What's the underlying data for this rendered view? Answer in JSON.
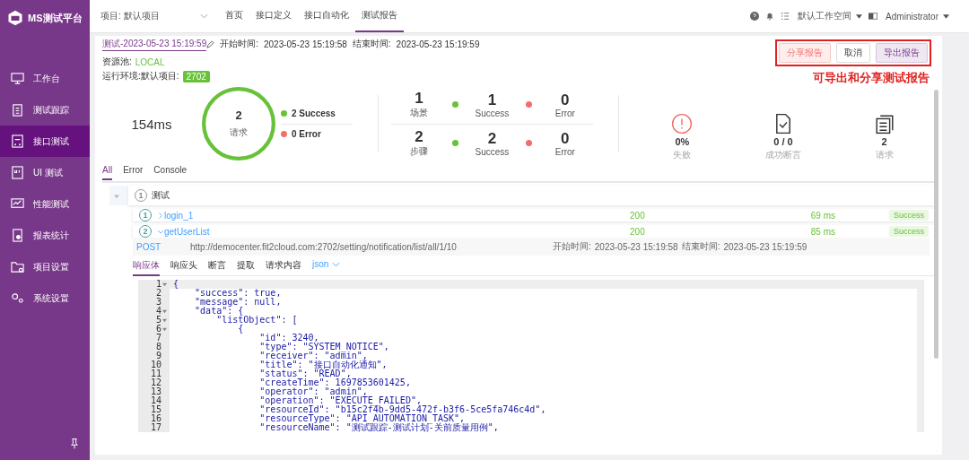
{
  "sidebar": {
    "logo": "MS测试平台",
    "items": [
      {
        "label": "工作台",
        "selected": false
      },
      {
        "label": "测试跟踪",
        "selected": false
      },
      {
        "label": "接口测试",
        "selected": true
      },
      {
        "label": "UI 测试",
        "selected": false
      },
      {
        "label": "性能测试",
        "selected": false
      },
      {
        "label": "报表统计",
        "selected": false
      },
      {
        "label": "项目设置",
        "selected": false
      },
      {
        "label": "系统设置",
        "selected": false
      }
    ]
  },
  "header": {
    "project": "项目: 默认项目",
    "nav": [
      {
        "label": "首页",
        "selected": false
      },
      {
        "label": "接口定义",
        "selected": false
      },
      {
        "label": "接口自动化",
        "selected": false
      },
      {
        "label": "测试报告",
        "selected": true
      }
    ],
    "workspace": "默认工作空间",
    "user": "Administrator"
  },
  "report": {
    "name": "测试-2023-05-23 15:19:59",
    "start_label": "开始时间:",
    "start": "2023-05-23 15:19:58",
    "end_label": "结束时间:",
    "end": "2023-05-23 15:19:59",
    "pool_label": "资源池:",
    "pool": "LOCAL",
    "env_label": "运行环境:默认项目:",
    "env_tag": "2702",
    "actions": [
      {
        "label": "分享报告",
        "kind": "share"
      },
      {
        "label": "取消",
        "kind": "plain"
      },
      {
        "label": "导出报告",
        "kind": "export"
      }
    ],
    "annotation": "可导出和分享测试报告",
    "duration": "154ms",
    "ring": {
      "count": "2",
      "label": "请求",
      "level": 1
    },
    "legend": [
      {
        "text": "2 Success",
        "color": "#67c23a"
      },
      {
        "text": "0 Error",
        "color": "#f56c6c"
      }
    ],
    "counts": [
      {
        "value": "1",
        "label": "场景",
        "success": "1",
        "success_label": "Success",
        "error": "0",
        "error_label": "Error"
      },
      {
        "value": "2",
        "label": "步骤",
        "success": "2",
        "success_label": "Success",
        "error": "0",
        "error_label": "Error"
      }
    ],
    "metrics": [
      {
        "value": "0%",
        "label": "失败"
      },
      {
        "value": "0 / 0",
        "label": "成功断言"
      },
      {
        "value": "2",
        "label": "请求"
      }
    ],
    "tabs": [
      {
        "label": "All",
        "selected": true
      },
      {
        "label": "Error",
        "selected": false
      },
      {
        "label": "Console",
        "selected": false
      }
    ],
    "tree": {
      "index": "1",
      "name": "测试",
      "expanded": true,
      "children": [
        {
          "index": "1",
          "name": "login_1",
          "expanded": false,
          "code": "200",
          "time": "69 ms",
          "status": "Success"
        },
        {
          "index": "2",
          "name": "getUserList",
          "expanded": true,
          "code": "200",
          "time": "85 ms",
          "status": "Success",
          "detail": {
            "method": "POST",
            "url": "http://democenter.fit2cloud.com:2702/setting/notification/list/all/1/10",
            "start_label": "开始时间:",
            "start": "2023-05-23 15:19:58",
            "end_label": "结束时间:",
            "end": "2023-05-23 15:19:59",
            "tabs": [
              {
                "label": "响应体",
                "selected": true
              },
              {
                "label": "响应头",
                "selected": false
              },
              {
                "label": "断言",
                "selected": false
              },
              {
                "label": "提取",
                "selected": false
              },
              {
                "label": "请求内容",
                "selected": false
              }
            ],
            "format": "json",
            "code": [
              {
                "no": "1",
                "fold": true,
                "text": "{"
              },
              {
                "no": "2",
                "fold": false,
                "text": "    \"success\": true,"
              },
              {
                "no": "3",
                "fold": false,
                "text": "    \"message\": null,"
              },
              {
                "no": "4",
                "fold": true,
                "text": "    \"data\": {"
              },
              {
                "no": "5",
                "fold": true,
                "text": "        \"listObject\": ["
              },
              {
                "no": "6",
                "fold": true,
                "text": "            {"
              },
              {
                "no": "7",
                "fold": false,
                "text": "                \"id\": 3240,"
              },
              {
                "no": "8",
                "fold": false,
                "text": "                \"type\": \"SYSTEM_NOTICE\","
              },
              {
                "no": "9",
                "fold": false,
                "text": "                \"receiver\": \"admin\","
              },
              {
                "no": "10",
                "fold": false,
                "text": "                \"title\": \"接口自动化通知\","
              },
              {
                "no": "11",
                "fold": false,
                "text": "                \"status\": \"READ\","
              },
              {
                "no": "12",
                "fold": false,
                "text": "                \"createTime\": 1697853601425,"
              },
              {
                "no": "13",
                "fold": false,
                "text": "                \"operator\": \"admin\","
              },
              {
                "no": "14",
                "fold": false,
                "text": "                \"operation\": \"EXECUTE_FAILED\","
              },
              {
                "no": "15",
                "fold": false,
                "text": "                \"resourceId\": \"b15c2f4b-9dd5-472f-b3f6-5ce5fa746c4d\","
              },
              {
                "no": "16",
                "fold": false,
                "text": "                \"resourceType\": \"API_AUTOMATION_TASK\","
              },
              {
                "no": "17",
                "fold": false,
                "text": "                \"resourceName\": \"测试跟踪-测试计划-关前质量用例\","
              }
            ]
          }
        }
      ]
    }
  }
}
